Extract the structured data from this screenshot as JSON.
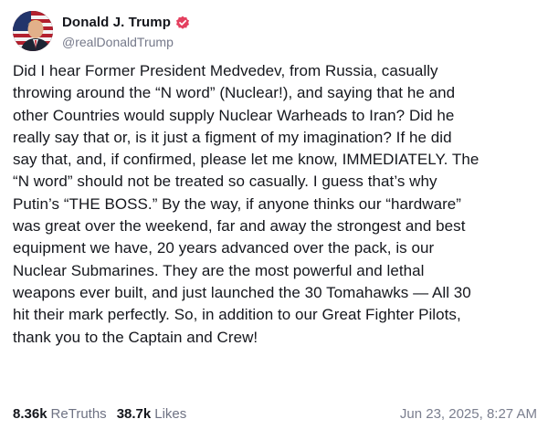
{
  "author": {
    "display_name": "Donald J. Trump",
    "handle": "@realDonaldTrump",
    "verified_color": "#e4405f"
  },
  "post": {
    "lines": [
      "Did I hear Former President Medvedev, from Russia, casually",
      "throwing around the “N word” (Nuclear!), and saying that he and",
      "other Countries would supply Nuclear Warheads to Iran? Did he",
      "really say that or, is it just a figment of my imagination? If he did",
      "say that, and, if confirmed, please let me know, IMMEDIATELY. The",
      "“N word” should not be treated so casually. I guess that’s why",
      "Putin’s “THE BOSS.” By the way, if anyone thinks our “hardware”",
      "was great over the weekend, far and away the strongest and best",
      "equipment we have, 20 years advanced over the pack, is our",
      "Nuclear Submarines. They are the most powerful and lethal",
      "weapons ever built, and just launched the 30 Tomahawks — All 30",
      "hit their mark perfectly. So, in addition to our Great Fighter Pilots,",
      "thank you to the Captain and Crew!"
    ]
  },
  "stats": {
    "retruths_count": "8.36k",
    "retruths_label": "ReTruths",
    "likes_count": "38.7k",
    "likes_label": "Likes"
  },
  "timestamp": "Jun 23, 2025, 8:27 AM",
  "icons": {
    "verified": "verified-badge-icon"
  }
}
